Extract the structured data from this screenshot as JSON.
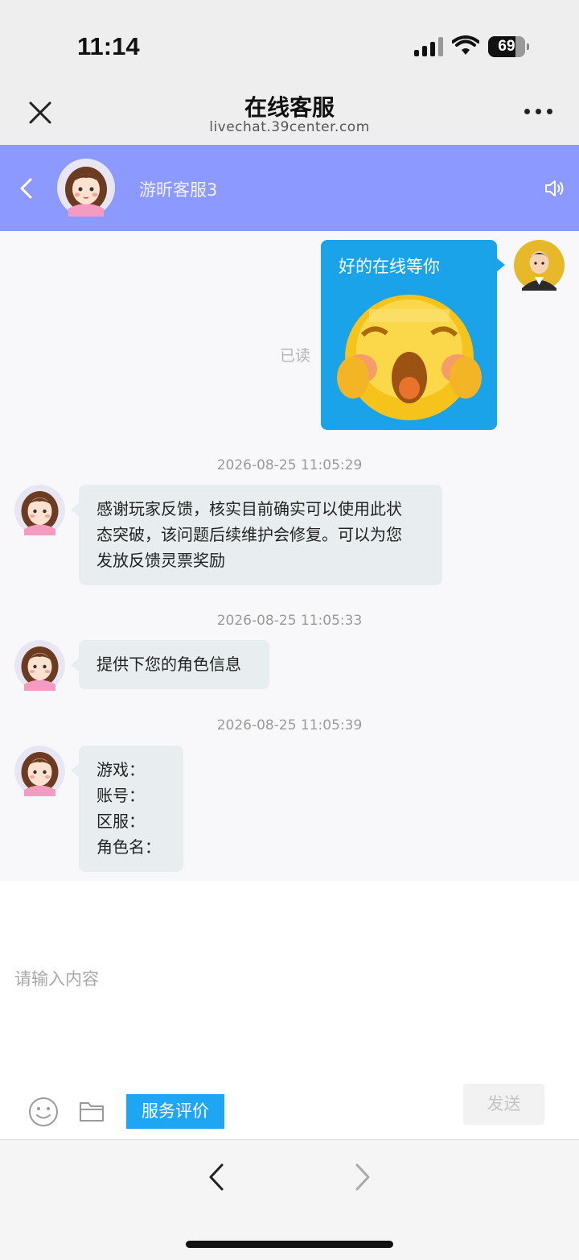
{
  "status": {
    "time": "11:14",
    "battery": "69"
  },
  "browser": {
    "title": "在线客服",
    "url": "livechat.39center.com"
  },
  "chat_header": {
    "agent_name": "游昕客服3"
  },
  "messages": {
    "outgoing": {
      "text": "好的在线等你",
      "read_status": "已读",
      "emoji": "crying-face-emoji"
    },
    "m1": {
      "time": "2026-08-25 11:05:29",
      "lines": [
        "感谢玩家反馈，核实目前确实可以使用此状",
        "态突破，该问题后续维护会修复。可以为您",
        "发放反馈灵票奖励"
      ]
    },
    "m2": {
      "time": "2026-08-25 11:05:33",
      "lines": [
        "提供下您的角色信息"
      ]
    },
    "m3": {
      "time": "2026-08-25 11:05:39",
      "lines": [
        "游戏：",
        "账号：",
        "区服：",
        "角色名："
      ]
    }
  },
  "input": {
    "placeholder": "请输入内容",
    "review_label": "服务评价",
    "send_label": "发送"
  },
  "colors": {
    "header_bg": "#8c99ff",
    "outgoing_bubble": "#1aa3e8",
    "incoming_bubble": "#e8edef",
    "review_button": "#1ea5f4"
  }
}
